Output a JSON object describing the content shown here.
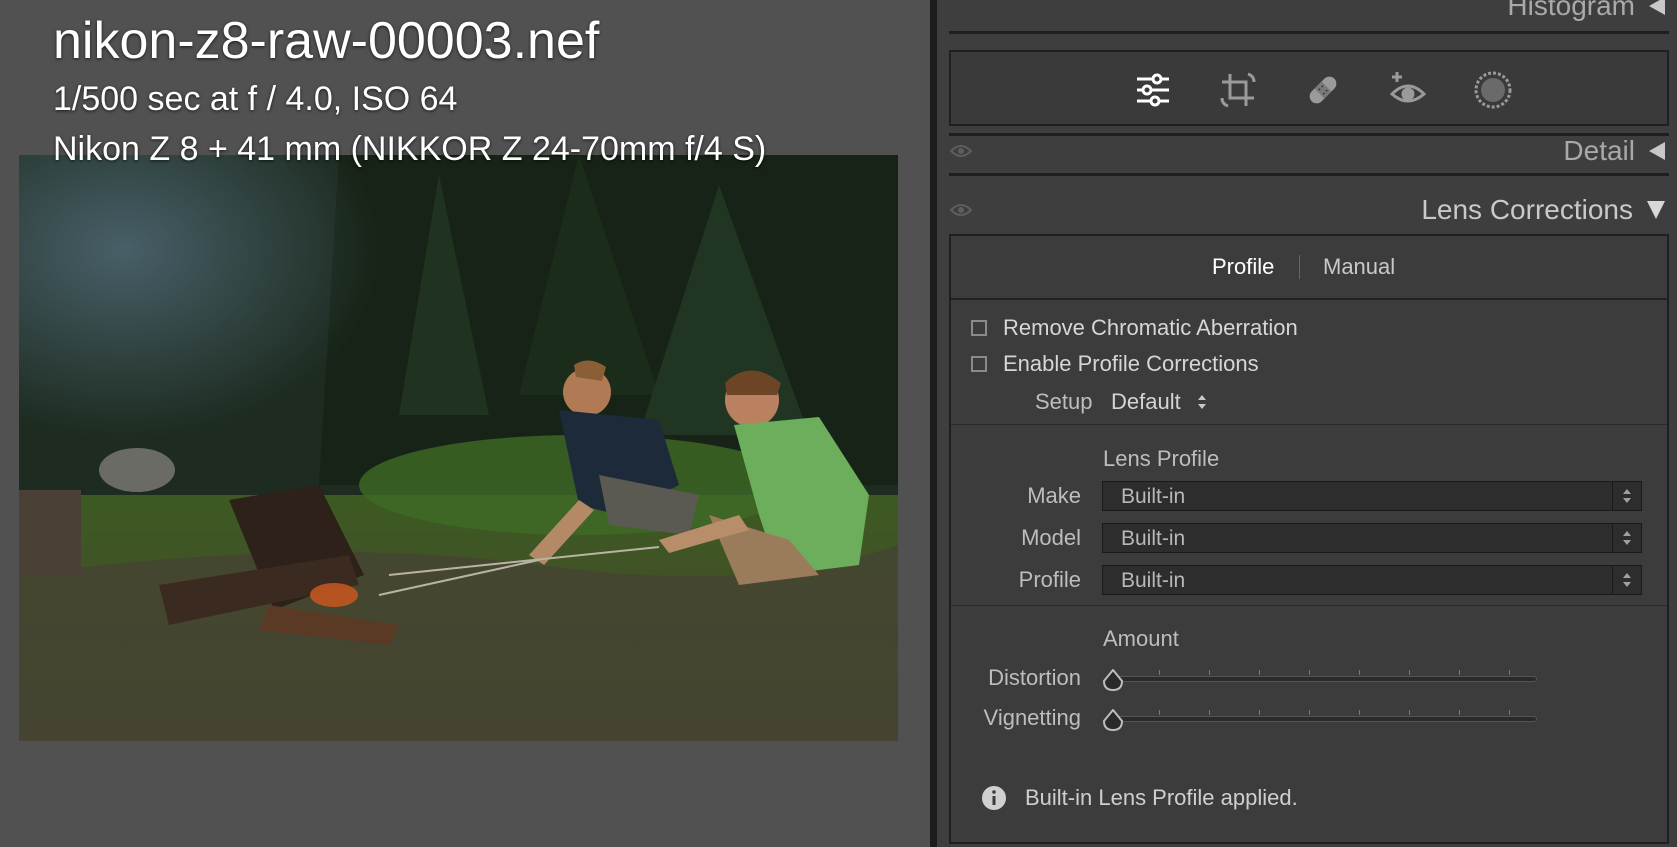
{
  "image": {
    "filename": "nikon-z8-raw-00003.nef",
    "exposure": "1/500 sec at f / 4.0, ISO 64",
    "camera": "Nikon Z 8 + 41 mm (NIKKOR Z 24-70mm f/4 S)"
  },
  "panel": {
    "histogram_label": "Histogram",
    "detail_label": "Detail",
    "lens_corrections_label": "Lens Corrections",
    "tools": [
      "sliders-icon",
      "crop-icon",
      "healing-icon",
      "red-eye-icon",
      "mask-icon"
    ],
    "tabs": {
      "profile": "Profile",
      "manual": "Manual",
      "active": "Profile"
    },
    "checkboxes": {
      "remove_ca": {
        "label": "Remove Chromatic Aberration",
        "checked": false
      },
      "enable_profile": {
        "label": "Enable Profile Corrections",
        "checked": false
      }
    },
    "setup": {
      "label": "Setup",
      "value": "Default"
    },
    "lens_profile": {
      "heading": "Lens Profile",
      "make": {
        "label": "Make",
        "value": "Built-in"
      },
      "model": {
        "label": "Model",
        "value": "Built-in"
      },
      "profile": {
        "label": "Profile",
        "value": "Built-in"
      }
    },
    "amount": {
      "heading": "Amount",
      "distortion": {
        "label": "Distortion",
        "level": 0
      },
      "vignetting": {
        "label": "Vignetting",
        "level": 0
      }
    },
    "info": "Built-in Lens Profile applied."
  }
}
